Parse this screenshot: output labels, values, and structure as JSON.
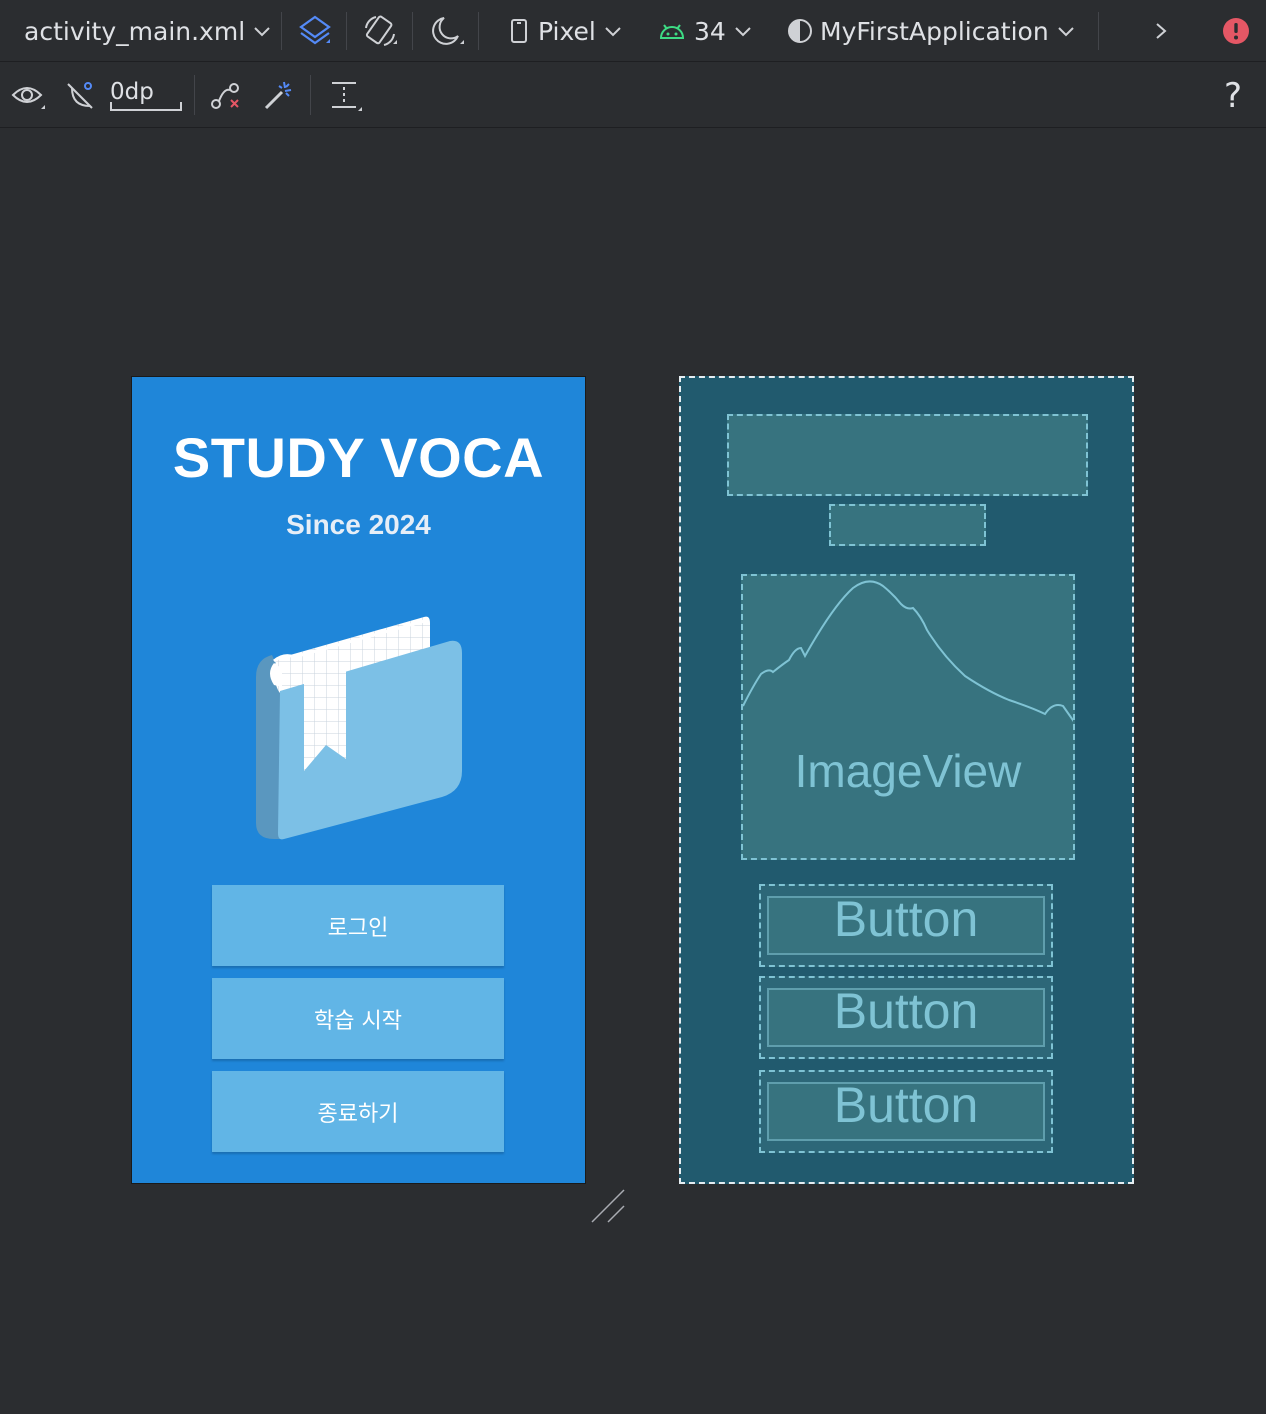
{
  "toolbar": {
    "file_name": "activity_main.xml",
    "device": "Pixel",
    "api_level": "34",
    "theme": "MyFirstApplication",
    "margin_value": "0dp",
    "help": "?"
  },
  "design_preview": {
    "title": "STUDY VOCA",
    "subtitle": "Since 2024",
    "buttons": [
      {
        "label": "로그인"
      },
      {
        "label": "학습 시작"
      },
      {
        "label": "종료하기"
      }
    ]
  },
  "blueprint": {
    "image_label": "ImageView",
    "buttons": [
      {
        "label": "Button"
      },
      {
        "label": "Button"
      },
      {
        "label": "Button"
      }
    ]
  },
  "colors": {
    "background": "#2b2d30",
    "design_bg": "#1f86d9",
    "design_button": "#61b5e6",
    "blueprint_bg": "#215a6e",
    "blueprint_line": "#7fc3d4",
    "android_green": "#3ddc84",
    "error_red": "#e55765",
    "accent_blue": "#548af7"
  },
  "icons": [
    "chevron-down-icon",
    "layers-icon",
    "rotate-icon",
    "night-mode-icon",
    "phone-icon",
    "android-icon",
    "theme-icon",
    "chevron-right-icon",
    "error-icon",
    "eye-icon",
    "autoconnect-icon",
    "infer-constraints-icon",
    "magic-wand-icon",
    "baseline-icon",
    "help-icon"
  ]
}
